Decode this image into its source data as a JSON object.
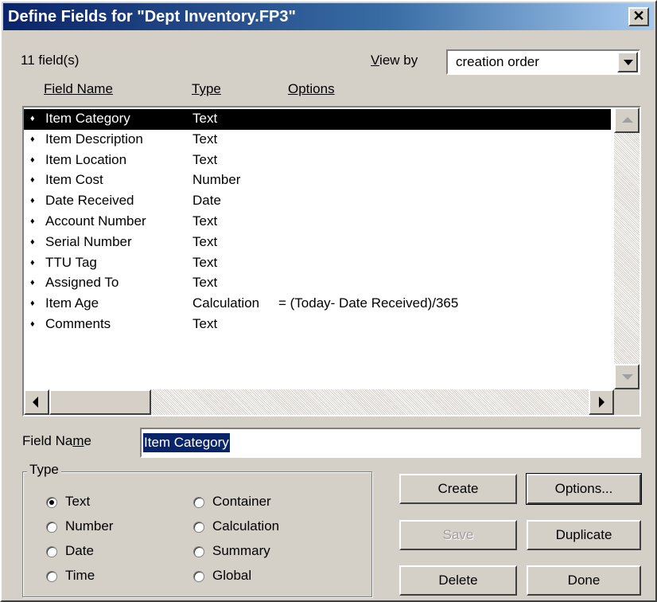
{
  "window": {
    "title": "Define Fields for \"Dept Inventory.FP3\"",
    "close": "✕"
  },
  "field_count": "11 field(s)",
  "view_by": {
    "label_pre": "",
    "label_ul": "V",
    "label_post": "iew by",
    "value": "creation order"
  },
  "columns": {
    "name": "Field Name",
    "type": "Type",
    "options": "Options"
  },
  "fields": [
    {
      "marker": "♦",
      "name": "Item Category",
      "type": "Text",
      "options": ""
    },
    {
      "marker": "♦",
      "name": "Item Description",
      "type": "Text",
      "options": ""
    },
    {
      "marker": "♦",
      "name": "Item Location",
      "type": "Text",
      "options": ""
    },
    {
      "marker": "♦",
      "name": "Item Cost",
      "type": "Number",
      "options": ""
    },
    {
      "marker": "♦",
      "name": "Date Received",
      "type": "Date",
      "options": ""
    },
    {
      "marker": "♦",
      "name": "Account Number",
      "type": "Text",
      "options": ""
    },
    {
      "marker": "♦",
      "name": "Serial Number",
      "type": "Text",
      "options": ""
    },
    {
      "marker": "♦",
      "name": "TTU Tag",
      "type": "Text",
      "options": ""
    },
    {
      "marker": "♦",
      "name": "Assigned To",
      "type": "Text",
      "options": ""
    },
    {
      "marker": "♦",
      "name": "Item Age",
      "type": "Calculation",
      "options": "= (Today- Date Received)/365"
    },
    {
      "marker": "♦",
      "name": "Comments",
      "type": "Text",
      "options": ""
    }
  ],
  "field_name": {
    "label_pre": "Field Na",
    "label_ul": "m",
    "label_post": "e",
    "value": "Item Category"
  },
  "type_group": {
    "label": "Type",
    "options": [
      "Text",
      "Number",
      "Date",
      "Time",
      "Container",
      "Calculation",
      "Summary",
      "Global"
    ],
    "selected": "Text"
  },
  "buttons": {
    "create": "Create",
    "options": "Options...",
    "save": "Save",
    "duplicate": "Duplicate",
    "delete": "Delete",
    "done": "Done"
  }
}
